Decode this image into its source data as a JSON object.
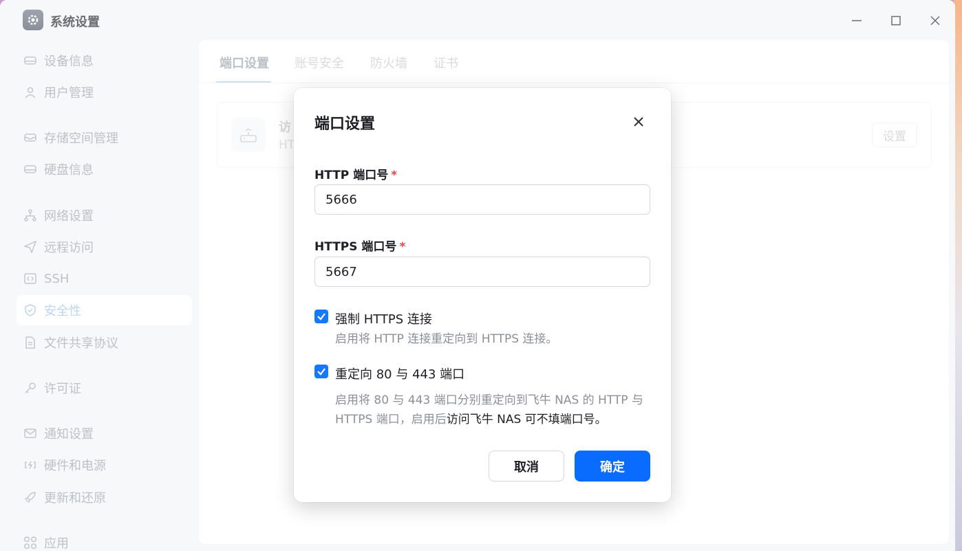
{
  "window": {
    "title": "系统设置"
  },
  "sidebar": {
    "items": [
      {
        "label": "设备信息",
        "icon": "device-icon"
      },
      {
        "label": "用户管理",
        "icon": "user-icon"
      },
      {
        "label": "存储空间管理",
        "icon": "storage-icon"
      },
      {
        "label": "硬盘信息",
        "icon": "disk-icon"
      },
      {
        "label": "网络设置",
        "icon": "network-icon"
      },
      {
        "label": "远程访问",
        "icon": "send-icon"
      },
      {
        "label": "SSH",
        "icon": "code-icon"
      },
      {
        "label": "安全性",
        "icon": "shield-icon",
        "active": true
      },
      {
        "label": "文件共享协议",
        "icon": "file-icon"
      },
      {
        "label": "许可证",
        "icon": "key-icon"
      },
      {
        "label": "通知设置",
        "icon": "mail-icon"
      },
      {
        "label": "硬件和电源",
        "icon": "power-icon"
      },
      {
        "label": "更新和还原",
        "icon": "rocket-icon"
      },
      {
        "label": "应用",
        "icon": "apps-icon"
      }
    ]
  },
  "tabs": [
    {
      "label": "端口设置",
      "active": true
    },
    {
      "label": "账号安全"
    },
    {
      "label": "防火墙"
    },
    {
      "label": "证书"
    }
  ],
  "card": {
    "title": "访",
    "subtitle": "HT",
    "button": "设置"
  },
  "dialog": {
    "title": "端口设置",
    "http_label": "HTTP 端口号",
    "http_value": "5666",
    "https_label": "HTTPS 端口号",
    "https_value": "5667",
    "required_mark": "*",
    "force_https": {
      "label": "强制 HTTPS 连接",
      "checked": true,
      "desc": "启用将 HTTP 连接重定向到 HTTPS 连接。"
    },
    "redirect": {
      "label": "重定向 80 与 443 端口",
      "checked": true,
      "desc_part1": "启用将 80 与 443 端口分别重定向到飞牛 NAS 的 HTTP 与 HTTPS 端口，启用后",
      "desc_part2": "访问飞牛 NAS 可不填端口号。"
    },
    "cancel": "取消",
    "confirm": "确定"
  },
  "colors": {
    "accent": "#0a6cff",
    "required": "#e5484d"
  }
}
